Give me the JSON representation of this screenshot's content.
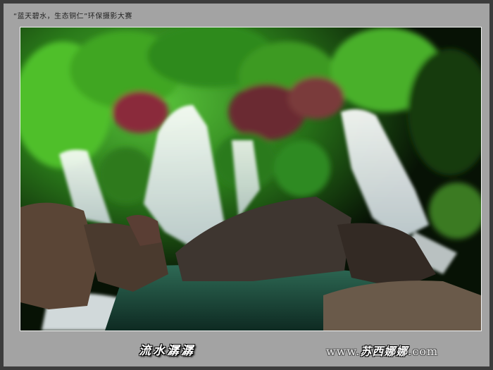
{
  "caption": {
    "contest": "“蓝天碧水，生态铜仁”环保摄影大赛"
  },
  "photo": {
    "subject": "waterfall-in-forest",
    "colors": {
      "foliage": "#2f8a1e",
      "water": "#e8eef0",
      "rock": "#4a3a30",
      "pool": "#1f4a3c"
    }
  },
  "footer": {
    "title": "流水潺潺",
    "website_prefix": "www.",
    "website_name": "苏西娜娜",
    "website_suffix": ".com"
  }
}
